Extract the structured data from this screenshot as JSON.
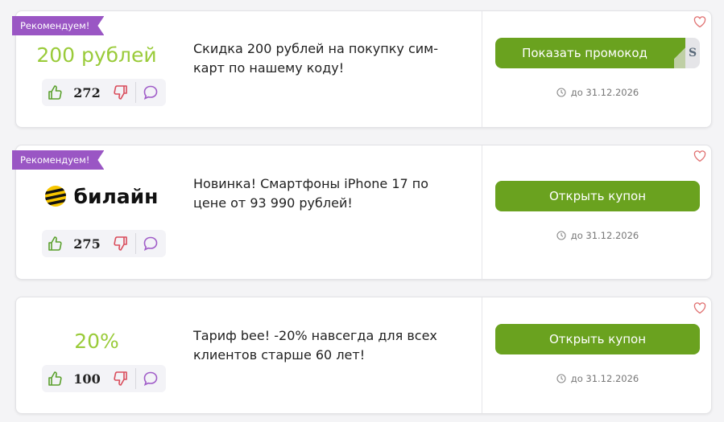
{
  "coupons": [
    {
      "badge": "Рекомендуем!",
      "brand_text": "200 рублей",
      "votes": "272",
      "description": "Скидка 200 рублей на покупку сим-карт по нашему коду!",
      "button_label": "Показать промокод",
      "code_peek": "S",
      "expiry": "до 31.12.2026"
    },
    {
      "badge": "Рекомендуем!",
      "brand_text": "билайн",
      "votes": "275",
      "description": "Новинка! Смартфоны iPhone 17 по цене от 93 990 рублей!",
      "button_label": "Открыть купон",
      "expiry": "до 31.12.2026"
    },
    {
      "brand_text": "20%",
      "votes": "100",
      "description": "Тариф bee! -20% навсегда для всех клиентов старше 60 лет!",
      "button_label": "Открыть купон",
      "expiry": "до 31.12.2026"
    }
  ],
  "colors": {
    "accent_green": "#6aa21f",
    "brand_text_green": "#9acb3a",
    "badge_purple": "#9a56c4",
    "like_green": "#5aa02c",
    "dislike_red": "#d94b5a",
    "comment_purple": "#a05cc8",
    "heart_red": "#e07070"
  },
  "icons": {
    "like": "thumbs-up-icon",
    "dislike": "thumbs-down-icon",
    "comment": "speech-bubble-icon",
    "clock": "clock-icon",
    "favorite": "heart-icon"
  }
}
